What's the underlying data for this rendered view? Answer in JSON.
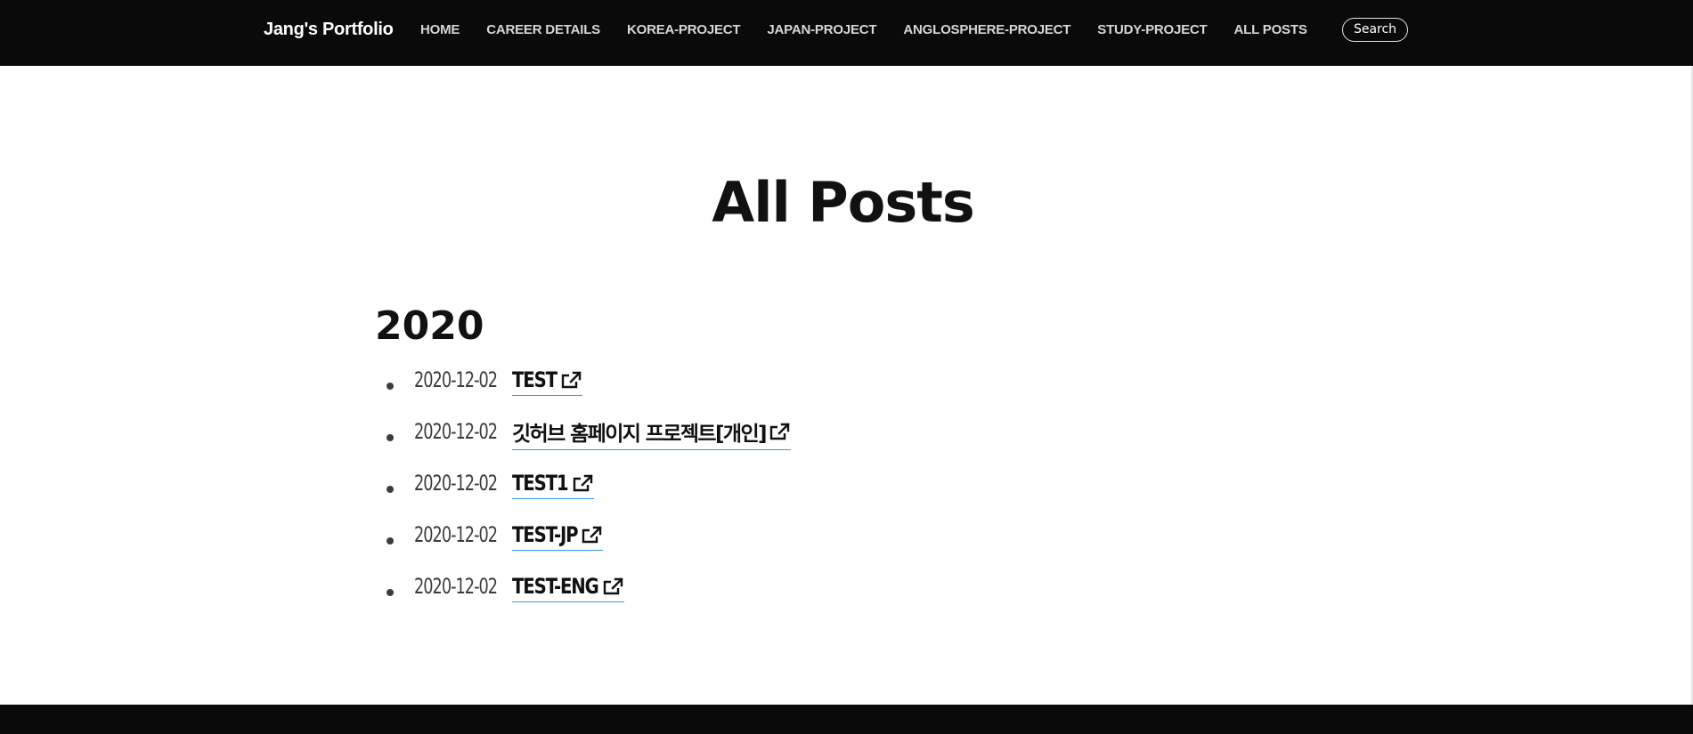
{
  "navbar": {
    "brand": "Jang's Portfolio",
    "links": [
      {
        "label": "HOME"
      },
      {
        "label": "CAREER DETAILS"
      },
      {
        "label": "KOREA-PROJECT"
      },
      {
        "label": "JAPAN-PROJECT"
      },
      {
        "label": "ANGLOSPHERE-PROJECT"
      },
      {
        "label": "STUDY-PROJECT"
      },
      {
        "label": "ALL POSTS"
      }
    ],
    "search_label": "Search"
  },
  "main": {
    "title": "All Posts",
    "groups": [
      {
        "year": "2020",
        "posts": [
          {
            "date": "2020-12-02",
            "title": "TEST",
            "icon": "external-link-icon"
          },
          {
            "date": "2020-12-02",
            "title": "깃허브 홈페이지 프로젝트[개인]",
            "icon": "external-link-icon"
          },
          {
            "date": "2020-12-02",
            "title": "TEST1",
            "icon": "external-link-icon"
          },
          {
            "date": "2020-12-02",
            "title": "TEST-JP",
            "icon": "external-link-icon"
          },
          {
            "date": "2020-12-02",
            "title": "TEST-ENG",
            "icon": "external-link-icon"
          }
        ]
      }
    ]
  },
  "colors": {
    "navbar_bg": "#0a0a0a",
    "link_underline": "#3c97e2",
    "text": "#111111",
    "date_text": "#3c3c3c"
  }
}
